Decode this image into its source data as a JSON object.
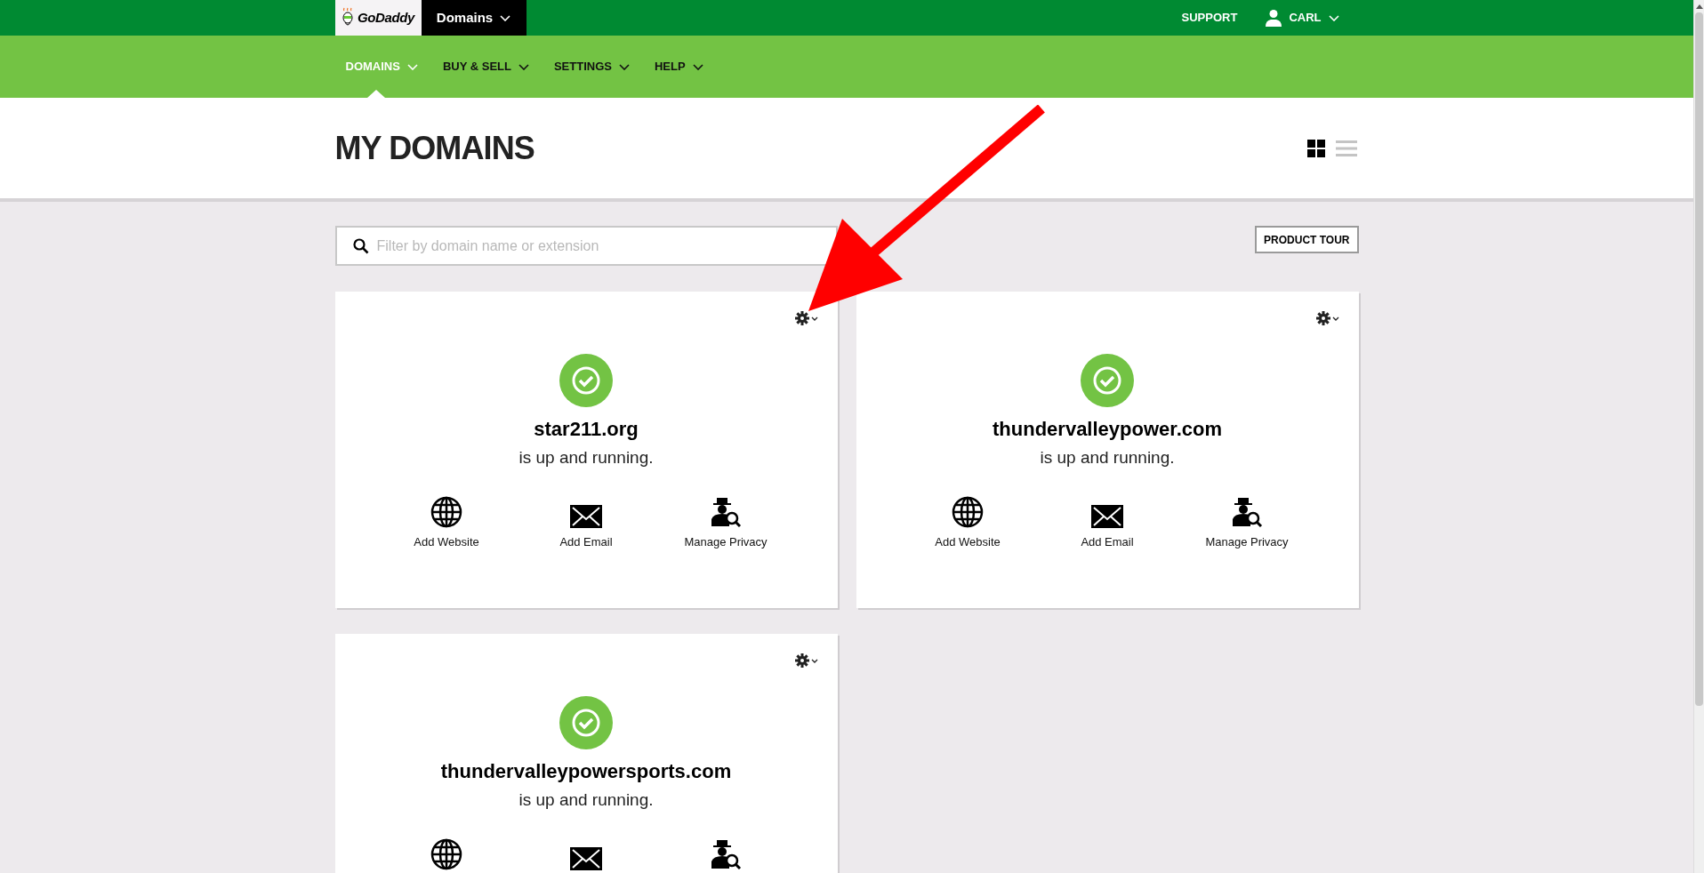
{
  "topbar": {
    "logo": "GoDaddy",
    "product_menu": "Domains",
    "support": "SUPPORT",
    "user": "CARL"
  },
  "nav": [
    {
      "label": "DOMAINS",
      "selected": true
    },
    {
      "label": "BUY & SELL",
      "selected": false
    },
    {
      "label": "SETTINGS",
      "selected": false
    },
    {
      "label": "HELP",
      "selected": false
    }
  ],
  "header": {
    "title": "MY DOMAINS",
    "views": [
      {
        "kind": "grid",
        "selected": true
      },
      {
        "kind": "list",
        "selected": false
      }
    ]
  },
  "search": {
    "placeholder": "Filter by domain name or extension"
  },
  "product_tour": "PRODUCT TOUR",
  "domains": [
    {
      "name": "star211.org",
      "running": true,
      "message": "is up and running.",
      "actions": [
        {
          "kind": "website",
          "label": "Add Website"
        },
        {
          "kind": "email",
          "label": "Add Email"
        },
        {
          "kind": "privacy",
          "label": "Manage Privacy"
        }
      ]
    },
    {
      "name": "thundervalleypower.com",
      "running": true,
      "message": "is up and running.",
      "actions": [
        {
          "kind": "website",
          "label": "Add Website"
        },
        {
          "kind": "email",
          "label": "Add Email"
        },
        {
          "kind": "privacy",
          "label": "Manage Privacy"
        }
      ]
    },
    {
      "name": "thundervalleypowersports.com",
      "running": true,
      "message": "is up and running.",
      "actions": [
        {
          "kind": "website"
        },
        {
          "kind": "email"
        },
        {
          "kind": "privacy"
        }
      ]
    }
  ]
}
